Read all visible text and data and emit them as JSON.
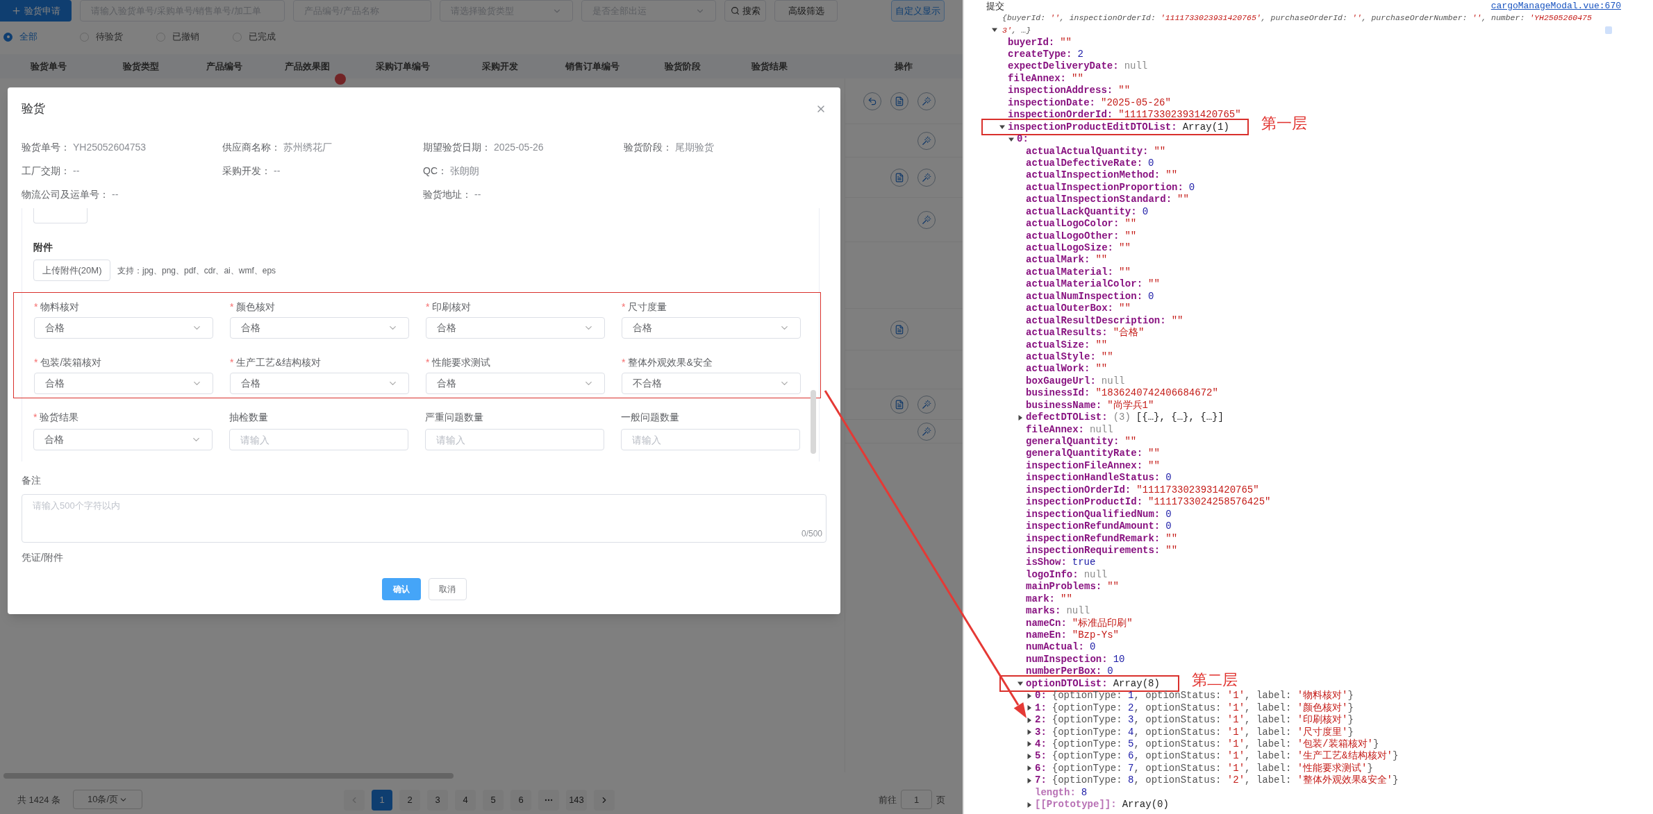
{
  "app": {
    "toolbar": {
      "create_button": "验货申请",
      "search_fields": [
        {
          "placeholder": "请输入验货单号/采购单号/销售单号/加工单",
          "kind": "input"
        },
        {
          "placeholder": "产品编号/产品名称",
          "kind": "input"
        },
        {
          "placeholder": "请选择验货类型",
          "kind": "select"
        },
        {
          "placeholder": "是否全部出运",
          "kind": "select"
        }
      ],
      "search_button": "搜索",
      "advanced_button": "高级筛选",
      "custom_button": "自定义显示"
    },
    "filters": [
      {
        "label": "全部",
        "selected": true
      },
      {
        "label": "待验货",
        "selected": false
      },
      {
        "label": "已撤销",
        "selected": false
      },
      {
        "label": "已完成",
        "selected": false
      }
    ],
    "table": {
      "columns": [
        "验货单号",
        "验货类型",
        "产品编号",
        "产品效果图",
        "采购订单编号",
        "采购开发",
        "销售订单编号",
        "验货阶段",
        "验货结果"
      ],
      "action_column": "操作"
    },
    "pagination": {
      "total": "共 1424 条",
      "page_size": "10条/页",
      "pages": [
        {
          "label": "1",
          "selected": true,
          "kind": "page"
        },
        {
          "label": "2",
          "selected": false,
          "kind": "page"
        },
        {
          "label": "3",
          "selected": false,
          "kind": "page"
        },
        {
          "label": "4",
          "selected": false,
          "kind": "page"
        },
        {
          "label": "5",
          "selected": false,
          "kind": "page"
        },
        {
          "label": "6",
          "selected": false,
          "kind": "page"
        },
        {
          "kind": "more",
          "selected": false
        },
        {
          "label": "143",
          "selected": false,
          "kind": "page"
        }
      ],
      "goto_label": "前往",
      "goto_value": "1",
      "goto_suffix": "页"
    }
  },
  "modal": {
    "title": "验货",
    "info_rows": [
      [
        {
          "label": "验货单号：",
          "value": "YH25052604753"
        },
        {
          "label": "供应商名称：",
          "value": "苏州绣花厂"
        },
        {
          "label": "期望验货日期：",
          "value": "2025-05-26"
        },
        {
          "label": "验货阶段：",
          "value": "尾期验货"
        }
      ],
      [
        {
          "label": "工厂交期：",
          "value": "--"
        },
        {
          "label": "采购开发：",
          "value": "--"
        },
        {
          "label": "QC：",
          "value": "张朗朗"
        }
      ],
      [
        {
          "label": "物流公司及运单号：",
          "value": "--",
          "wide": true
        },
        {
          "label": "验货地址：",
          "value": "--"
        }
      ]
    ],
    "attachment": {
      "heading": "附件",
      "upload_button": "上传附件(20M)",
      "hint": "支持：jpg、png、pdf、cdr、ai、wmf、eps"
    },
    "checks": [
      {
        "marker": "*",
        "label": "物料核对",
        "value": "合格"
      },
      {
        "marker": "*",
        "label": "颜色核对",
        "value": "合格"
      },
      {
        "marker": "*",
        "label": "印刷核对",
        "value": "合格"
      },
      {
        "marker": "*",
        "label": "尺寸度量",
        "value": "合格"
      },
      {
        "marker": "*",
        "label": "包装/装箱核对",
        "value": "合格"
      },
      {
        "marker": "*",
        "label": "生产工艺&结构核对",
        "value": "合格"
      },
      {
        "marker": "*",
        "label": "性能要求测试",
        "value": "合格"
      },
      {
        "marker": "*",
        "label": "整体外观效果&安全",
        "value": "不合格"
      }
    ],
    "result_fields": [
      {
        "marker": "*",
        "label": "验货结果",
        "kind": "select",
        "value": "合格"
      },
      {
        "label": "抽检数量",
        "kind": "input",
        "placeholder": "请输入"
      },
      {
        "label": "严重问题数量",
        "kind": "input",
        "placeholder": "请输入"
      },
      {
        "label": "一般问题数量",
        "kind": "input",
        "placeholder": "请输入"
      }
    ],
    "remark": {
      "label": "备注",
      "placeholder": "请输入500个字符以内",
      "counter": "0/500"
    },
    "voucher_label": "凭证/附件",
    "confirm_button": "确认",
    "cancel_button": "取消"
  },
  "console": {
    "message": "提交",
    "source": "cargoManageModal.vue:670",
    "object": {
      "preview": "{buyerId: '', inspectionOrderId: '1111733023931420765', purchaseOrderId: '', purchaseOrderNumber: '', number: 'YH25052604753', …}",
      "expanded": true,
      "children": [
        {
          "key": "buyerId:",
          "value": "\"\"",
          "kind": "string"
        },
        {
          "key": "createType:",
          "value": "2",
          "kind": "number"
        },
        {
          "key": "expectDeliveryDate:",
          "value": "null",
          "kind": "null"
        },
        {
          "key": "fileAnnex:",
          "value": "\"\"",
          "kind": "string"
        },
        {
          "key": "inspectionAddress:",
          "value": "\"\"",
          "kind": "string"
        },
        {
          "key": "inspectionDate:",
          "value": "\"2025-05-26\"",
          "kind": "string"
        },
        {
          "key": "inspectionOrderId:",
          "value": "\"1111733023931420765\"",
          "kind": "string"
        },
        {
          "key": "inspectionProductEditDTOList:",
          "value": "Array(1)",
          "kind": "object",
          "expanded": true,
          "annotation": "第一层",
          "children": [
            {
              "key": "0:",
              "expanded": true,
              "children": [
                {
                  "key": "actualActualQuantity:",
                  "value": "\"\"",
                  "kind": "string"
                },
                {
                  "key": "actualDefectiveRate:",
                  "value": "0",
                  "kind": "number"
                },
                {
                  "key": "actualInspectionMethod:",
                  "value": "\"\"",
                  "kind": "string"
                },
                {
                  "key": "actualInspectionProportion:",
                  "value": "0",
                  "kind": "number"
                },
                {
                  "key": "actualInspectionStandard:",
                  "value": "\"\"",
                  "kind": "string"
                },
                {
                  "key": "actualLackQuantity:",
                  "value": "0",
                  "kind": "number"
                },
                {
                  "key": "actualLogoColor:",
                  "value": "\"\"",
                  "kind": "string"
                },
                {
                  "key": "actualLogoOther:",
                  "value": "\"\"",
                  "kind": "string"
                },
                {
                  "key": "actualLogoSize:",
                  "value": "\"\"",
                  "kind": "string"
                },
                {
                  "key": "actualMark:",
                  "value": "\"\"",
                  "kind": "string"
                },
                {
                  "key": "actualMaterial:",
                  "value": "\"\"",
                  "kind": "string"
                },
                {
                  "key": "actualMaterialColor:",
                  "value": "\"\"",
                  "kind": "string"
                },
                {
                  "key": "actualNumInspection:",
                  "value": "0",
                  "kind": "number"
                },
                {
                  "key": "actualOuterBox:",
                  "value": "\"\"",
                  "kind": "string"
                },
                {
                  "key": "actualResultDescription:",
                  "value": "\"\"",
                  "kind": "string"
                },
                {
                  "key": "actualResults:",
                  "value": "\"合格\"",
                  "kind": "string"
                },
                {
                  "key": "actualSize:",
                  "value": "\"\"",
                  "kind": "string"
                },
                {
                  "key": "actualStyle:",
                  "value": "\"\"",
                  "kind": "string"
                },
                {
                  "key": "actualWork:",
                  "value": "\"\"",
                  "kind": "string"
                },
                {
                  "key": "boxGaugeUrl:",
                  "value": "null",
                  "kind": "null"
                },
                {
                  "key": "businessId:",
                  "value": "\"1836240742406684672\"",
                  "kind": "string"
                },
                {
                  "key": "businessName:",
                  "value": "\"尚学兵1\"",
                  "kind": "string"
                },
                {
                  "key": "defectDTOList:",
                  "count": "(3)",
                  "value": "[{…}, {…}, {…}]",
                  "kind": "object",
                  "expanded": false
                },
                {
                  "key": "fileAnnex:",
                  "value": "null",
                  "kind": "null"
                },
                {
                  "key": "generalQuantity:",
                  "value": "\"\"",
                  "kind": "string"
                },
                {
                  "key": "generalQuantityRate:",
                  "value": "\"\"",
                  "kind": "string"
                },
                {
                  "key": "inspectionFileAnnex:",
                  "value": "\"\"",
                  "kind": "string"
                },
                {
                  "key": "inspectionHandleStatus:",
                  "value": "0",
                  "kind": "number"
                },
                {
                  "key": "inspectionOrderId:",
                  "value": "\"1111733023931420765\"",
                  "kind": "string"
                },
                {
                  "key": "inspectionProductId:",
                  "value": "\"1111733024258576425\"",
                  "kind": "string"
                },
                {
                  "key": "inspectionQualifiedNum:",
                  "value": "0",
                  "kind": "number"
                },
                {
                  "key": "inspectionRefundAmount:",
                  "value": "0",
                  "kind": "number"
                },
                {
                  "key": "inspectionRefundRemark:",
                  "value": "\"\"",
                  "kind": "string"
                },
                {
                  "key": "inspectionRequirements:",
                  "value": "\"\"",
                  "kind": "string"
                },
                {
                  "key": "isShow:",
                  "value": "true",
                  "kind": "boolean"
                },
                {
                  "key": "logoInfo:",
                  "value": "null",
                  "kind": "null"
                },
                {
                  "key": "mainProblems:",
                  "value": "\"\"",
                  "kind": "string"
                },
                {
                  "key": "mark:",
                  "value": "\"\"",
                  "kind": "string"
                },
                {
                  "key": "marks:",
                  "value": "null",
                  "kind": "null"
                },
                {
                  "key": "nameCn:",
                  "value": "\"标准品印刷\"",
                  "kind": "string"
                },
                {
                  "key": "nameEn:",
                  "value": "\"Bzp-Ys\"",
                  "kind": "string"
                },
                {
                  "key": "numActual:",
                  "value": "0",
                  "kind": "number"
                },
                {
                  "key": "numInspection:",
                  "value": "10",
                  "kind": "number"
                },
                {
                  "key": "numberPerBox:",
                  "value": "0",
                  "kind": "number"
                },
                {
                  "key": "optionDTOList:",
                  "value": "Array(8)",
                  "kind": "object",
                  "expanded": true,
                  "annotation": "第二层",
                  "children": [
                    {
                      "key": "0:",
                      "value": "{optionType: 1, optionStatus: '1', label: '物料核对'}",
                      "kind": "preview",
                      "expanded": false
                    },
                    {
                      "key": "1:",
                      "value": "{optionType: 2, optionStatus: '1', label: '颜色核对'}",
                      "kind": "preview",
                      "expanded": false
                    },
                    {
                      "key": "2:",
                      "value": "{optionType: 3, optionStatus: '1', label: '印刷核对'}",
                      "kind": "preview",
                      "expanded": false
                    },
                    {
                      "key": "3:",
                      "value": "{optionType: 4, optionStatus: '1', label: '尺寸度里'}",
                      "kind": "preview",
                      "expanded": false
                    },
                    {
                      "key": "4:",
                      "value": "{optionType: 5, optionStatus: '1', label: '包装/装箱核对'}",
                      "kind": "preview",
                      "expanded": false
                    },
                    {
                      "key": "5:",
                      "value": "{optionType: 6, optionStatus: '1', label: '生产工艺&结构核对'}",
                      "kind": "preview",
                      "expanded": false
                    },
                    {
                      "key": "6:",
                      "value": "{optionType: 7, optionStatus: '1', label: '性能要求测试'}",
                      "kind": "preview",
                      "expanded": false
                    },
                    {
                      "key": "7:",
                      "value": "{optionType: 8, optionStatus: '2', label: '整体外观效果&安全'}",
                      "kind": "preview",
                      "expanded": false
                    },
                    {
                      "key": "length:",
                      "value": "8",
                      "kind": "number",
                      "internal": true
                    },
                    {
                      "key": "[[Prototype]]:",
                      "value": "Array(0)",
                      "kind": "object",
                      "expanded": false,
                      "internal": true
                    }
                  ]
                }
              ]
            }
          ]
        }
      ]
    }
  }
}
